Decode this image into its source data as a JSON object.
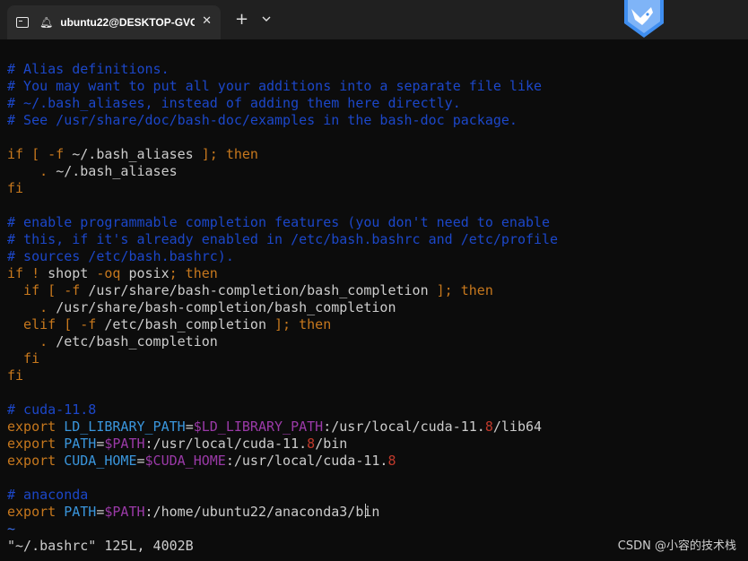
{
  "window": {
    "tab_title": "ubuntu22@DESKTOP-GVC",
    "close_glyph": "✕",
    "new_tab_glyph": "+",
    "dropdown_glyph": "⌄"
  },
  "colors": {
    "comment": "#1c47c9",
    "keyword": "#c7781d",
    "default": "#cccccc",
    "variable": "#9b3aa8",
    "identifier": "#3a96dd",
    "number": "#c0392b",
    "tilde": "#3a6ee8",
    "background": "#0c0c0c",
    "titlebar": "#202020"
  },
  "editor_lines": [
    [
      {
        "t": "# Alias definitions.",
        "c": "comment"
      }
    ],
    [
      {
        "t": "# You may want to put all your additions into a separate file like",
        "c": "comment"
      }
    ],
    [
      {
        "t": "# ~/.bash_aliases, instead of adding them here directly.",
        "c": "comment"
      }
    ],
    [
      {
        "t": "# See /usr/share/doc/bash-doc/examples in the bash-doc package.",
        "c": "comment"
      }
    ],
    [],
    [
      {
        "t": "if [ -f ",
        "c": "keyword"
      },
      {
        "t": "~/.bash_aliases",
        "c": "default"
      },
      {
        "t": " ]; then",
        "c": "keyword"
      }
    ],
    [
      {
        "t": "    . ",
        "c": "keyword"
      },
      {
        "t": "~/.bash_aliases",
        "c": "default"
      }
    ],
    [
      {
        "t": "fi",
        "c": "keyword"
      }
    ],
    [],
    [
      {
        "t": "# enable programmable completion features (you don't need to enable",
        "c": "comment"
      }
    ],
    [
      {
        "t": "# this, if it's already enabled in /etc/bash.bashrc and /etc/profile",
        "c": "comment"
      }
    ],
    [
      {
        "t": "# sources /etc/bash.bashrc).",
        "c": "comment"
      }
    ],
    [
      {
        "t": "if ! ",
        "c": "keyword"
      },
      {
        "t": "shopt ",
        "c": "default"
      },
      {
        "t": "-oq ",
        "c": "keyword"
      },
      {
        "t": "posix",
        "c": "default"
      },
      {
        "t": "; then",
        "c": "keyword"
      }
    ],
    [
      {
        "t": "  if [ -f ",
        "c": "keyword"
      },
      {
        "t": "/usr/share/bash-completion/bash_completion",
        "c": "default"
      },
      {
        "t": " ]; then",
        "c": "keyword"
      }
    ],
    [
      {
        "t": "    . ",
        "c": "keyword"
      },
      {
        "t": "/usr/share/bash-completion/bash_completion",
        "c": "default"
      }
    ],
    [
      {
        "t": "  elif [ -f ",
        "c": "keyword"
      },
      {
        "t": "/etc/bash_completion",
        "c": "default"
      },
      {
        "t": " ]; then",
        "c": "keyword"
      }
    ],
    [
      {
        "t": "    . ",
        "c": "keyword"
      },
      {
        "t": "/etc/bash_completion",
        "c": "default"
      }
    ],
    [
      {
        "t": "  fi",
        "c": "keyword"
      }
    ],
    [
      {
        "t": "fi",
        "c": "keyword"
      }
    ],
    [],
    [
      {
        "t": "# cuda-11.8",
        "c": "comment"
      }
    ],
    [
      {
        "t": "export ",
        "c": "keyword"
      },
      {
        "t": "LD_LIBRARY_PATH",
        "c": "identifier"
      },
      {
        "t": "=",
        "c": "default"
      },
      {
        "t": "$LD_LIBRARY_PATH",
        "c": "variable"
      },
      {
        "t": ":/usr/local/cuda-11.",
        "c": "default"
      },
      {
        "t": "8",
        "c": "number"
      },
      {
        "t": "/lib64",
        "c": "default"
      }
    ],
    [
      {
        "t": "export ",
        "c": "keyword"
      },
      {
        "t": "PATH",
        "c": "identifier"
      },
      {
        "t": "=",
        "c": "default"
      },
      {
        "t": "$PATH",
        "c": "variable"
      },
      {
        "t": ":/usr/local/cuda-11.",
        "c": "default"
      },
      {
        "t": "8",
        "c": "number"
      },
      {
        "t": "/bin",
        "c": "default"
      }
    ],
    [
      {
        "t": "export ",
        "c": "keyword"
      },
      {
        "t": "CUDA_HOME",
        "c": "identifier"
      },
      {
        "t": "=",
        "c": "default"
      },
      {
        "t": "$CUDA_HOME",
        "c": "variable"
      },
      {
        "t": ":/usr/local/cuda-11.",
        "c": "default"
      },
      {
        "t": "8",
        "c": "number"
      }
    ],
    [],
    [
      {
        "t": "# anaconda",
        "c": "comment"
      }
    ],
    [
      {
        "t": "export ",
        "c": "keyword"
      },
      {
        "t": "PATH",
        "c": "identifier"
      },
      {
        "t": "=",
        "c": "default"
      },
      {
        "t": "$PATH",
        "c": "variable"
      },
      {
        "t": ":/home/ubuntu22/anaconda3/bin",
        "c": "default"
      }
    ],
    [
      {
        "t": "~",
        "c": "tilde"
      }
    ]
  ],
  "status_line": "\"~/.bashrc\" 125L, 4002B",
  "watermark": "CSDN @小容的技术栈"
}
